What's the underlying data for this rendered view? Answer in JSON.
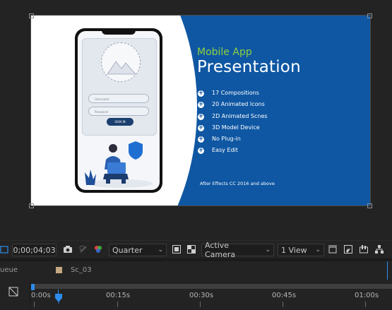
{
  "composition": {
    "subtitle": "Mobile App",
    "title": "Presentation",
    "features": [
      "17 Compositions",
      "20 Animated Icons",
      "2D Animated Scnes",
      "3D Model Device",
      "No Plug-in",
      "Easy Edit"
    ],
    "footnote": "After Effects CC 2016 and above",
    "phone": {
      "username_placeholder": "Username",
      "password_placeholder": "Password",
      "login_label": "SIGN IN"
    },
    "colors": {
      "background": "#0f57a3",
      "accent": "#8fd13f",
      "text": "#ffffff"
    }
  },
  "toolbar": {
    "timecode": "0;00;04;03",
    "resolution": "Quarter",
    "camera": "Active Camera",
    "views": "1 View"
  },
  "panel": {
    "left_tab": "ueue",
    "comp_tab": "Sc_03",
    "comp_tab_color": "#c4a882"
  },
  "timeline": {
    "ticks": [
      "0:00s",
      "00:15s",
      "00:30s",
      "00:45s",
      "01:00s"
    ]
  }
}
